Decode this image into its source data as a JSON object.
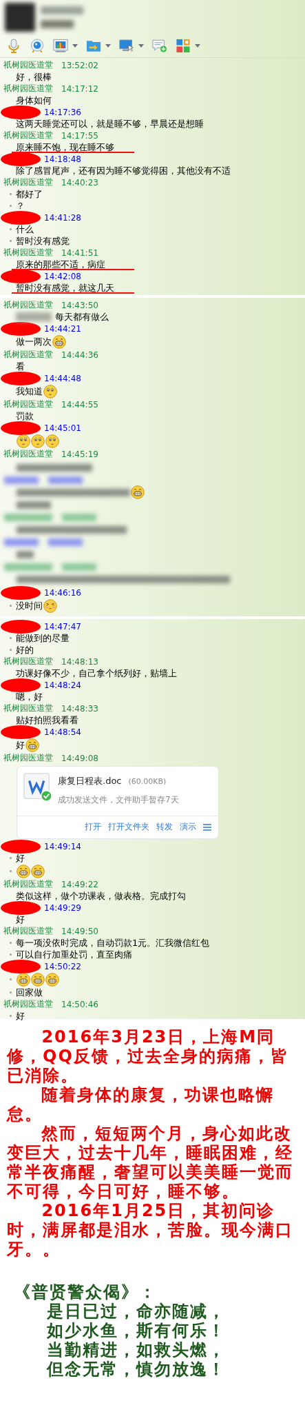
{
  "panels": [
    {
      "toolbar": [
        {
          "kind": "microphone",
          "dropdown": false
        },
        {
          "kind": "webcam",
          "dropdown": false
        },
        {
          "kind": "chart",
          "dropdown": true
        },
        {
          "kind": "folder",
          "dropdown": true
        },
        {
          "kind": "monitor",
          "dropdown": true
        },
        {
          "kind": "chat-add",
          "dropdown": false
        },
        {
          "kind": "apps",
          "dropdown": true
        }
      ],
      "messages": [
        {
          "kind": "doctor",
          "name": "祇树园医道堂",
          "time": "13:52:02",
          "lines": [
            {
              "text": "好，很棒",
              "bullet": false,
              "underlined": false
            }
          ]
        },
        {
          "kind": "doctor",
          "name": "祇树园医道堂",
          "time": "14:17:12",
          "lines": [
            {
              "text": "身体如何",
              "bullet": false,
              "underlined": false
            }
          ]
        },
        {
          "kind": "patient",
          "time": "14:17:36",
          "lines": [
            {
              "text": "这两天睡觉还可以，就是睡不够，早晨还是想睡",
              "bullet": false,
              "underlined": false
            }
          ]
        },
        {
          "kind": "doctor",
          "name": "祇树园医道堂",
          "time": "14:17:55",
          "lines": [
            {
              "text": "原来睡不饱，现在睡不够",
              "bullet": false,
              "underlined": true
            }
          ]
        },
        {
          "kind": "patient",
          "time": "14:18:48",
          "lines": [
            {
              "text": "除了感冒尾声，还有因为睡不够觉得困，其他没有不适",
              "bullet": false,
              "underlined": false
            }
          ]
        },
        {
          "kind": "doctor",
          "name": "祇树园医道堂",
          "time": "14:40:23",
          "lines": [
            {
              "text": "都好了",
              "bullet": true,
              "underlined": false
            },
            {
              "text": "？",
              "bullet": true,
              "underlined": false
            }
          ]
        },
        {
          "kind": "patient",
          "time": "14:41:28",
          "lines": [
            {
              "text": "什么",
              "bullet": true,
              "underlined": false
            },
            {
              "text": "暂时没有感觉",
              "bullet": true,
              "underlined": false
            }
          ]
        },
        {
          "kind": "doctor",
          "name": "祇树园医道堂",
          "time": "14:41:51",
          "lines": [
            {
              "text": "原来的那些不适，病症",
              "bullet": false,
              "underlined": true
            }
          ]
        },
        {
          "kind": "patient",
          "time": "14:42:08",
          "lines": [
            {
              "text": "暂时没有感觉，就这几天",
              "bullet": false,
              "underlined": true
            }
          ]
        }
      ]
    },
    {
      "messages": [
        {
          "kind": "doctor",
          "name": "祇树园医道堂",
          "time": "14:43:50",
          "lines": [
            {
              "text": "每天都有做么",
              "bullet": false,
              "underlined": false,
              "blurred_prefix": true
            }
          ]
        },
        {
          "kind": "patient",
          "time": "14:44:21",
          "lines": [
            {
              "text": "做一两次",
              "bullet": false,
              "underlined": false,
              "emoji": [
                {
                  "kind": "grin"
                }
              ]
            }
          ]
        },
        {
          "kind": "doctor",
          "name": "祇树园医道堂",
          "time": "14:44:36",
          "lines": [
            {
              "text": "看",
              "bullet": false,
              "underlined": false
            }
          ]
        },
        {
          "kind": "patient",
          "time": "14:44:48",
          "lines": [
            {
              "text": "我知道",
              "bullet": false,
              "underlined": false,
              "emoji": [
                {
                  "kind": "smile"
                }
              ]
            }
          ]
        },
        {
          "kind": "doctor",
          "name": "祇树园医道堂",
          "time": "14:44:55",
          "lines": [
            {
              "text": "罚款",
              "bullet": false,
              "underlined": false
            }
          ]
        },
        {
          "kind": "patient",
          "time": "14:45:01",
          "lines": [
            {
              "bullet": false,
              "underlined": false,
              "emoji": [
                {
                  "kind": "smile"
                },
                {
                  "kind": "smile"
                },
                {
                  "kind": "smile"
                }
              ]
            }
          ]
        },
        {
          "kind": "doctor",
          "name": "祇树园医道堂",
          "time": "14:45:19"
        },
        {
          "kind": "blurred",
          "emoji": [
            {
              "kind": "grin"
            }
          ]
        },
        {
          "kind": "patient",
          "time": "14:46:16",
          "lines": [
            {
              "text": "没时间",
              "bullet": true,
              "underlined": false,
              "emoji": [
                {
                  "kind": "blush"
                }
              ]
            }
          ]
        }
      ]
    },
    {
      "messages": [
        {
          "kind": "patient",
          "time": "14:47:47",
          "lines": [
            {
              "text": "能做到的尽量",
              "bullet": true,
              "underlined": false
            },
            {
              "text": "好的",
              "bullet": true,
              "underlined": false
            }
          ]
        },
        {
          "kind": "doctor",
          "name": "祇树园医道堂",
          "time": "14:48:13",
          "lines": [
            {
              "text": "功课好像不少，自己拿个纸列好，贴墙上",
              "bullet": false,
              "underlined": false
            }
          ]
        },
        {
          "kind": "patient",
          "time": "14:48:24",
          "lines": [
            {
              "text": "嗯，好",
              "bullet": false,
              "underlined": false
            }
          ]
        },
        {
          "kind": "doctor",
          "name": "祇树园医道堂",
          "time": "14:48:33",
          "lines": [
            {
              "text": "贴好拍照我看看",
              "bullet": false,
              "underlined": false
            }
          ]
        },
        {
          "kind": "patient",
          "time": "14:48:54",
          "lines": [
            {
              "text": "好",
              "bullet": false,
              "underlined": false,
              "emoji": [
                {
                  "kind": "grin"
                }
              ]
            }
          ]
        },
        {
          "kind": "doctor",
          "name": "祇树园医道堂",
          "time": "14:49:08",
          "file": {
            "name": "康复日程表.doc",
            "size": "(60.00KB)",
            "status": "成功发送文件，文件助手暂存7天",
            "actions": [
              "打开",
              "打开文件夹",
              "转发",
              "演示"
            ]
          }
        },
        {
          "kind": "patient",
          "time": "14:49:14",
          "lines": [
            {
              "text": "好",
              "bullet": true,
              "underlined": false
            },
            {
              "bullet": true,
              "underlined": false,
              "emoji": [
                {
                  "kind": "grin"
                },
                {
                  "kind": "grin"
                }
              ]
            }
          ]
        },
        {
          "kind": "doctor",
          "name": "祇树园医道堂",
          "time": "14:49:22",
          "lines": [
            {
              "text": "类似这样，做个功课表，做表格。完成打勾",
              "bullet": false,
              "underlined": false
            }
          ]
        },
        {
          "kind": "patient",
          "time": "14:49:29",
          "lines": [
            {
              "text": "好",
              "bullet": false,
              "underlined": false
            }
          ]
        },
        {
          "kind": "doctor",
          "name": "祇树园医道堂",
          "time": "14:49:50",
          "lines": [
            {
              "text": "每一项没依时完成，自动罚款1元。汇我微信红包",
              "bullet": true,
              "underlined": false
            },
            {
              "text": "可以自行加重处罚，直至肉痛",
              "bullet": true,
              "underlined": false
            }
          ]
        },
        {
          "kind": "patient",
          "time": "14:50:22",
          "lines": [
            {
              "bullet": true,
              "underlined": false,
              "emoji": [
                {
                  "kind": "grin"
                },
                {
                  "kind": "grin"
                },
                {
                  "kind": "grin"
                }
              ]
            },
            {
              "text": "回家做",
              "bullet": true,
              "underlined": false
            }
          ]
        },
        {
          "kind": "doctor",
          "name": "祇树园医道堂",
          "time": "14:50:46",
          "lines": [
            {
              "text": "好",
              "bullet": true,
              "underlined": false
            }
          ]
        }
      ]
    }
  ],
  "note": {
    "paragraphs": [
      "2016年3月23日，上海M同修，QQ反馈，过去全身的病痛，皆已消除。",
      "随着身体的康复，功课也略懈怠。",
      "然而，短短两个月，身心如此改变巨大，过去十几年，睡眠困难，经常半夜痛醒，奢望可以美美睡一觉而不可得，今日可好，睡不够。",
      "2016年1月25日，其初问诊时，满屏都是泪水，苦脸。现今满口牙。。"
    ]
  },
  "verse": {
    "title": "《普贤警众偈》：",
    "lines": [
      "是日已过，命亦随减，",
      "如少水鱼，斯有何乐！",
      "当勤精进，如救头燃，",
      "但念无常，慎勿放逸！"
    ]
  }
}
